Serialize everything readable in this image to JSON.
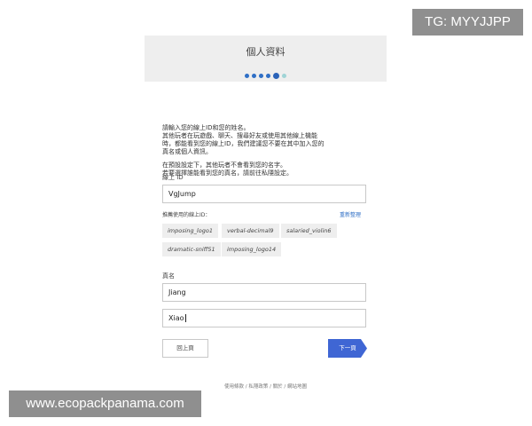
{
  "watermarks": {
    "top_right": "TG: MYYJJPP",
    "bottom_left": "www.ecopackpanama.com"
  },
  "header": {
    "title": "個人資料",
    "steps_total": 6,
    "current_step": 5
  },
  "intro": {
    "p1_lines": [
      "請輸入您的線上ID和您的姓名。",
      "其他玩者在玩遊戲、聊天、搜尋好友或使用其他線上機能",
      "時，都能看到您的線上ID，我們建議您不要在其中加入您的",
      "真名或個人資訊。"
    ],
    "p2_lines": [
      "在預設設定下，其他玩者不會看到您的名字。",
      "若要選擇誰能看到您的真名，請前往私隱設定。"
    ]
  },
  "online_id": {
    "label": "線上 ID",
    "value": "VgJump"
  },
  "suggestions": {
    "label": "推薦使用的線上ID：",
    "regenerate_label": "重新整理",
    "chips": [
      "imposing_logo1",
      "verbal-decimal9",
      "salaried_violin6",
      "dramatic-sniff51",
      "imposing_logo14"
    ]
  },
  "real_name": {
    "label": "真名",
    "first_value": "Jiang",
    "last_value": "Xiao"
  },
  "buttons": {
    "back_label": "回上頁",
    "next_label": "下一頁"
  },
  "footer": {
    "text": "使用條款 / 私隱政策 / 關於 / 網站地圖"
  }
}
